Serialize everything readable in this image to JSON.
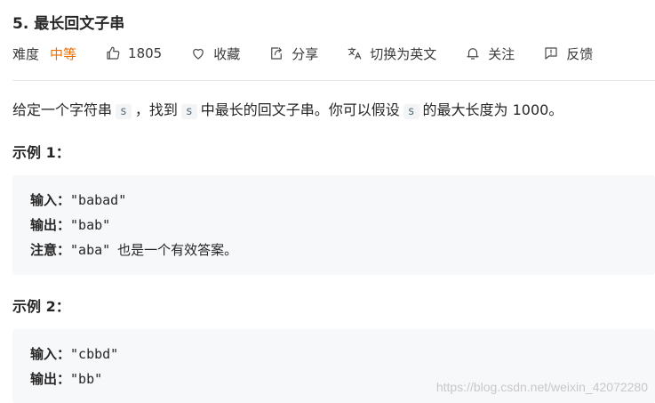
{
  "problem": {
    "title": "5. 最长回文子串",
    "difficulty_label": "难度",
    "difficulty_value": "中等",
    "difficulty_color": "#ef6c00"
  },
  "actions": {
    "like_count": "1805",
    "favorite_label": "收藏",
    "share_label": "分享",
    "switch_lang_label": "切换为英文",
    "follow_label": "关注",
    "feedback_label": "反馈"
  },
  "description": {
    "p1": "给定一个字符串",
    "code1": "s",
    "p2": "，找到",
    "code2": "s",
    "p3": "中最长的回文子串。你可以假设",
    "code3": "s",
    "p4": "的最大长度为 1000。"
  },
  "examples": [
    {
      "title": "示例 1：",
      "input_label": "输入：",
      "input_value": "\"babad\"",
      "output_label": "输出：",
      "output_value": "\"bab\"",
      "note_label": "注意：",
      "note_value": "\"aba\"",
      "note_text": "也是一个有效答案。"
    },
    {
      "title": "示例 2：",
      "input_label": "输入：",
      "input_value": "\"cbbd\"",
      "output_label": "输出：",
      "output_value": "\"bb\""
    }
  ],
  "watermark": "https://blog.csdn.net/weixin_42072280"
}
